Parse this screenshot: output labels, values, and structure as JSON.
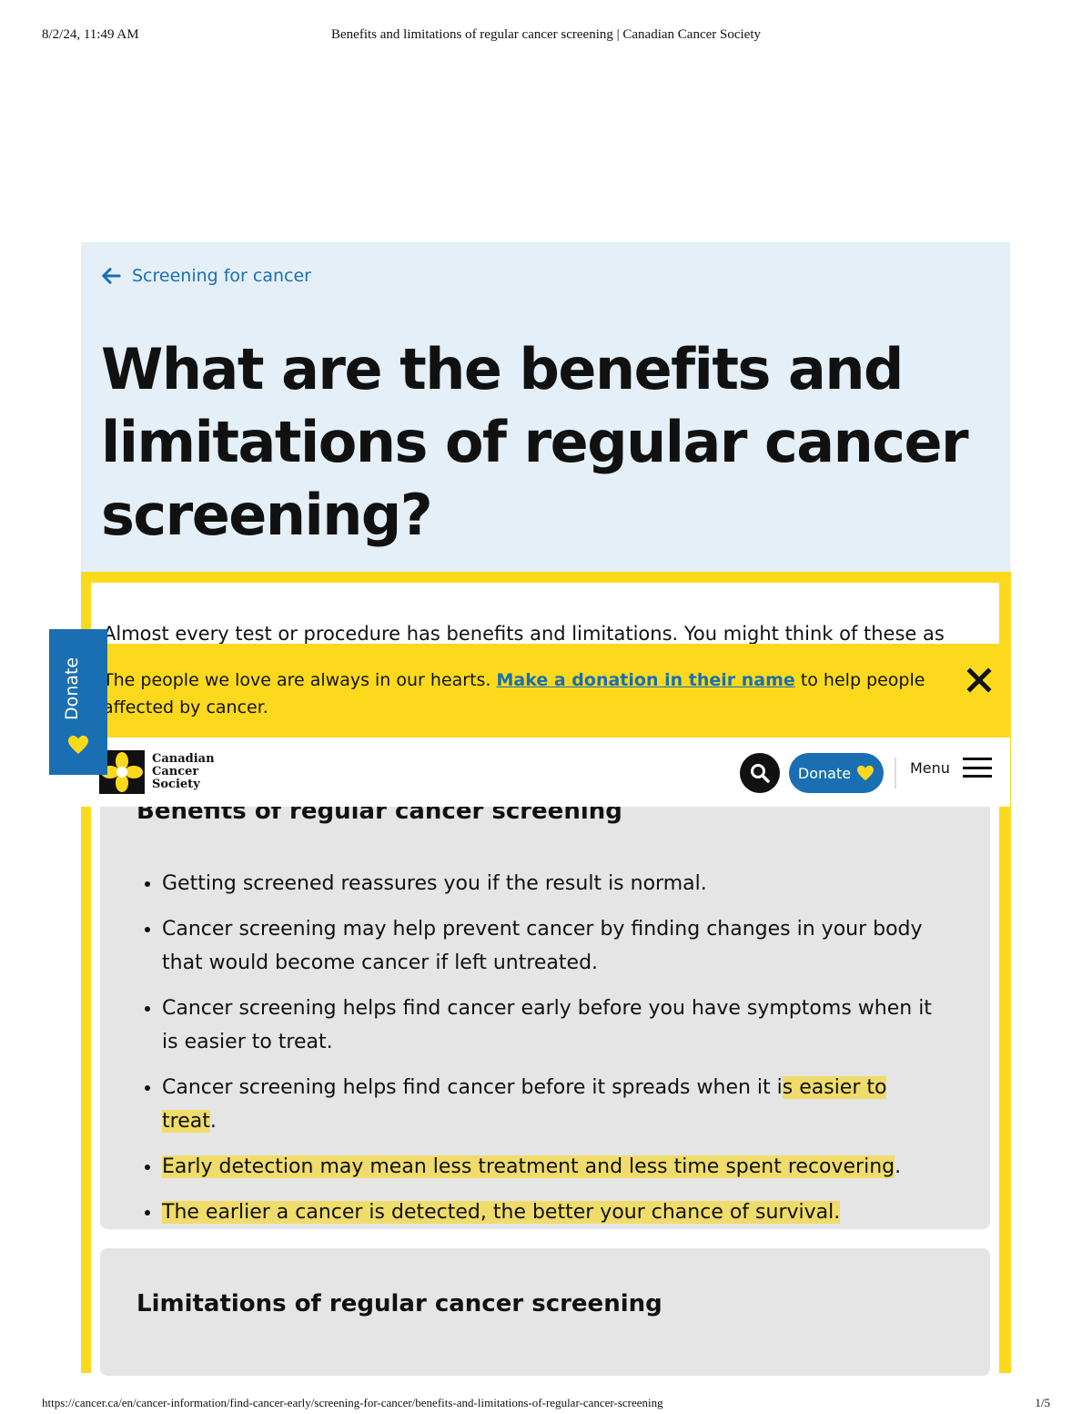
{
  "print_header": {
    "datetime": "8/2/24, 11:49 AM",
    "title": "Benefits and limitations of regular cancer screening | Canadian Cancer Society"
  },
  "print_footer": {
    "url": "https://cancer.ca/en/cancer-information/find-cancer-early/screening-for-cancer/benefits-and-limitations-of-regular-cancer-screening",
    "page": "1/5"
  },
  "breadcrumb": {
    "label": "Screening for cancer",
    "icon": "arrow-left-icon"
  },
  "hero": {
    "title": "What are the benefits and limitations of regular cancer screening?"
  },
  "intro": {
    "text": "Almost every test or procedure has benefits and limitations. You might think of these as"
  },
  "banner": {
    "text_before": "The people we love are always in our hearts. ",
    "link": "Make a donation in their name",
    "text_after": " to help people affected by cancer.",
    "close_icon": "close-icon"
  },
  "nav": {
    "logo_lines": [
      "Canadian",
      "Cancer",
      "Society"
    ],
    "donate_label": "Donate",
    "menu_label": "Menu"
  },
  "side_donate": {
    "label": "Donate"
  },
  "benefits": {
    "heading": "Benefits of regular cancer screening",
    "items": [
      {
        "text": "Getting screened reassures you if the result is normal.",
        "highlight": "",
        "after": ""
      },
      {
        "text": "Cancer screening may help prevent cancer by finding changes in your body that would become cancer if left untreated.",
        "highlight": "",
        "after": ""
      },
      {
        "text": "Cancer screening helps find cancer early before you have symptoms when it is easier to treat.",
        "highlight": "",
        "after": ""
      },
      {
        "text": "Cancer screening helps find cancer before it spreads when it i",
        "highlight": "s easier to treat",
        "after": "."
      },
      {
        "text": "",
        "highlight": "Early detection may mean less treatment and less time spent recovering",
        "after": "."
      },
      {
        "text": "",
        "highlight": "The earlier a cancer is detected, the better your chance of survival.",
        "after": ""
      }
    ]
  },
  "limitations": {
    "heading": "Limitations of regular cancer screening"
  },
  "colors": {
    "accent_blue": "#1a6fb3",
    "brand_yellow": "#fcd91c",
    "hero_bg": "#e4eff7",
    "highlight": "#f0dc6a"
  }
}
